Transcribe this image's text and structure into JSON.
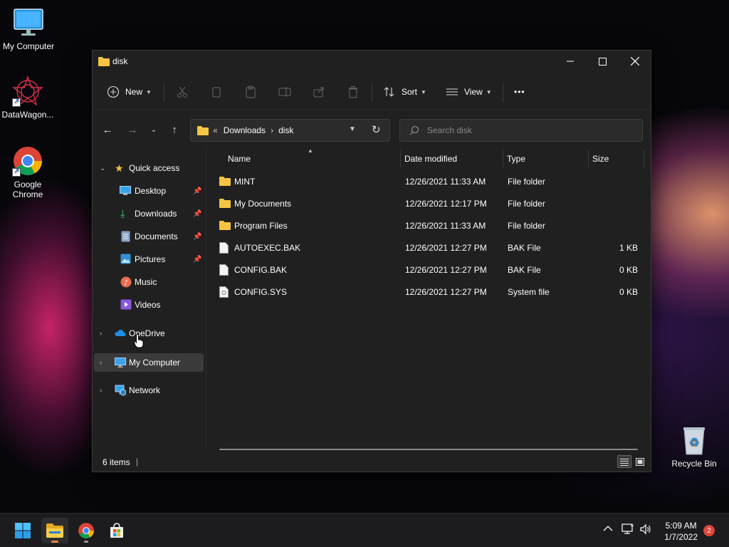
{
  "desktop": {
    "icons": [
      {
        "label": "My Computer"
      },
      {
        "label": "DataWagon..."
      },
      {
        "label": "Google\nChrome"
      },
      {
        "label": "Recycle Bin"
      }
    ]
  },
  "window": {
    "title": "disk",
    "toolbar": {
      "new_label": "New",
      "sort_label": "Sort",
      "view_label": "View",
      "more_label": "•••"
    },
    "address": {
      "overflow": "«",
      "crumbs": [
        "Downloads",
        "disk"
      ],
      "separator": "›"
    },
    "search": {
      "placeholder": "Search disk"
    },
    "sidebar": {
      "quick_access": "Quick access",
      "pinned": [
        {
          "label": "Desktop",
          "pinned": true
        },
        {
          "label": "Downloads",
          "pinned": true
        },
        {
          "label": "Documents",
          "pinned": true
        },
        {
          "label": "Pictures",
          "pinned": true
        },
        {
          "label": "Music",
          "pinned": false
        },
        {
          "label": "Videos",
          "pinned": false
        }
      ],
      "roots": [
        {
          "label": "OneDrive"
        },
        {
          "label": "My Computer",
          "selected": true
        },
        {
          "label": "Network"
        }
      ]
    },
    "columns": {
      "name": "Name",
      "date": "Date modified",
      "type": "Type",
      "size": "Size"
    },
    "files": [
      {
        "name": "MINT",
        "date": "12/26/2021 11:33 AM",
        "type": "File folder",
        "size": "",
        "kind": "folder"
      },
      {
        "name": "My Documents",
        "date": "12/26/2021 12:17 PM",
        "type": "File folder",
        "size": "",
        "kind": "folder"
      },
      {
        "name": "Program Files",
        "date": "12/26/2021 11:33 AM",
        "type": "File folder",
        "size": "",
        "kind": "folder"
      },
      {
        "name": "AUTOEXEC.BAK",
        "date": "12/26/2021 12:27 PM",
        "type": "BAK File",
        "size": "1 KB",
        "kind": "file"
      },
      {
        "name": "CONFIG.BAK",
        "date": "12/26/2021 12:27 PM",
        "type": "BAK File",
        "size": "0 KB",
        "kind": "file"
      },
      {
        "name": "CONFIG.SYS",
        "date": "12/26/2021 12:27 PM",
        "type": "System file",
        "size": "0 KB",
        "kind": "sysfile"
      }
    ],
    "status": {
      "item_count": "6 items",
      "cursor": "|"
    }
  },
  "taskbar": {
    "time": "5:09 AM",
    "date": "1/7/2022",
    "notifications": "2"
  },
  "colors": {
    "folder": "#f4c542",
    "accent": "#0078d4",
    "window_bg": "#202020"
  }
}
